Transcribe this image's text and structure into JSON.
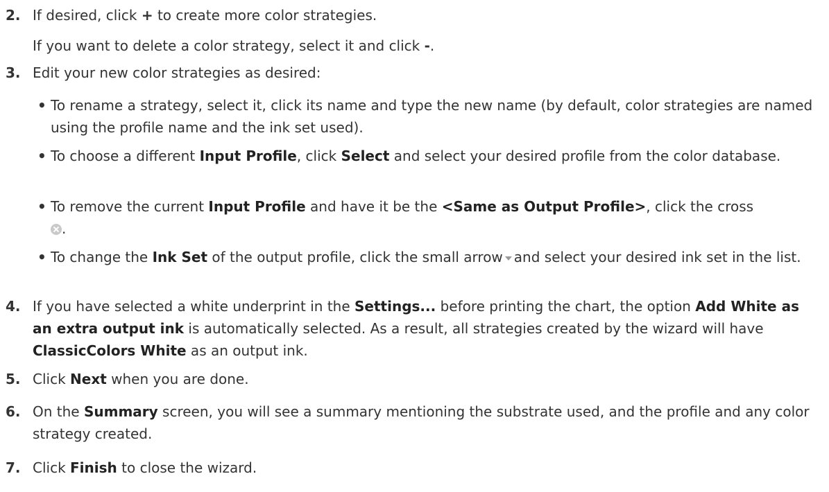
{
  "steps": [
    {
      "num": "2.",
      "a": "If desired, click ",
      "b1": "+",
      "c": " to create more color strategies."
    },
    {
      "extra_a": "If you want to delete a color strategy, select it and click ",
      "extra_b": "-",
      "extra_c": "."
    },
    {
      "num": "3.",
      "text": "Edit your new color strategies as desired:"
    },
    {
      "num": "4.",
      "a": "If you have selected a white underprint in the ",
      "b1": "Settings...",
      "c": " before printing the chart, the option ",
      "b2": "Add White as an extra output ink",
      "d": " is automatically selected. As a result, all strategies created by the wizard will have ",
      "b3": "ClassicColors White",
      "e": " as an output ink."
    },
    {
      "num": "5.",
      "a": "Click ",
      "b1": "Next",
      "c": " when you are done."
    },
    {
      "num": "6.",
      "a": "On the ",
      "b1": "Summary",
      "c": " screen, you will see a summary mentioning the substrate used, and the profile and any color strategy created."
    },
    {
      "num": "7.",
      "a": "Click ",
      "b1": "Finish",
      "c": " to close the wizard."
    }
  ],
  "bullets": [
    {
      "a": "To rename a strategy, select it, click its name and type the new name (by default, color strategies are named using the profile name and the ink set used)."
    },
    {
      "a": "To choose a different ",
      "b1": "Input Profile",
      "c": ", click ",
      "b2": "Select",
      "d": " and select your desired profile from the color database."
    },
    {
      "a": "To remove the current ",
      "b1": "Input Profile",
      "c": " and have it be the ",
      "b2": "<Same as Output Profile>",
      "d": ", click the cross",
      "e": "."
    },
    {
      "a": "To change the ",
      "b1": "Ink Set",
      "c": " of the output profile, click the small arrow",
      "d": "and select your desired ink set in the list."
    }
  ],
  "bullet_char": "•",
  "icons": {
    "cross": "cross-circle-icon",
    "arrow": "small-dropdown-arrow-icon"
  }
}
